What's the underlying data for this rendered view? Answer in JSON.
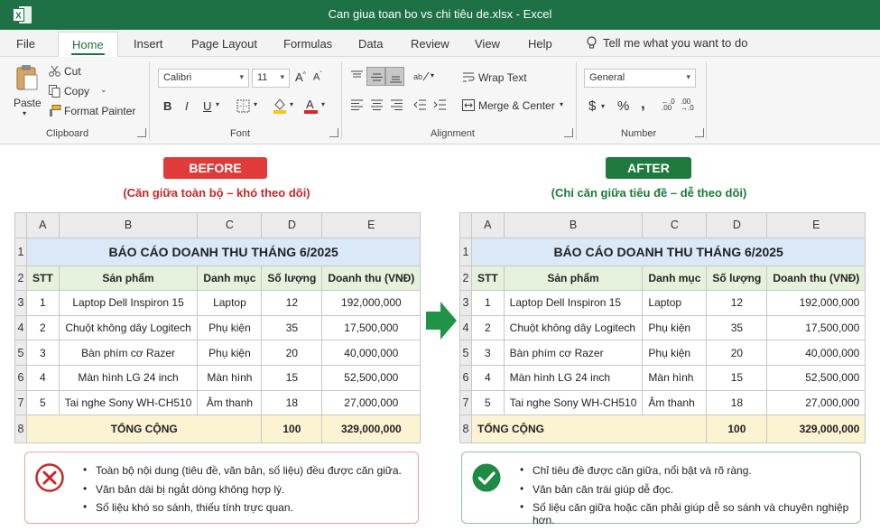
{
  "window": {
    "title": "Can giua toan bo vs chi tiêu de.xlsx  -  Excel",
    "accent": "#1e7145"
  },
  "menu": {
    "tabs": [
      "File",
      "Home",
      "Insert",
      "Page Layout",
      "Formulas",
      "Data",
      "Review",
      "View",
      "Help"
    ],
    "active": "Home",
    "tell_me": "Tell me what you want to do"
  },
  "ribbon": {
    "clipboard": {
      "paste": "Paste",
      "cut": "Cut",
      "copy": "Copy",
      "format_painter": "Format Painter",
      "label": "Clipboard"
    },
    "font": {
      "name": "Calibri",
      "size": "11",
      "bold": "B",
      "italic": "I",
      "underline": "U",
      "font_color_glyph": "A",
      "label": "Font",
      "fill_color": "#f5c518",
      "text_color": "#d9262c"
    },
    "alignment": {
      "wrap_text": "Wrap Text",
      "merge_center": "Merge & Center",
      "label": "Alignment"
    },
    "number": {
      "format": "General",
      "currency": "$",
      "percent": "%",
      "comma": ",",
      "label": "Number"
    }
  },
  "before": {
    "banner": "BEFORE",
    "caption": "(Căn giữa toàn bộ – khó theo dõi)",
    "color": "#e03b3b"
  },
  "after": {
    "banner": "AFTER",
    "caption": "(Chỉ căn giữa tiêu đề – dễ theo dõi)",
    "color": "#1f7a3e"
  },
  "sheet": {
    "columns": [
      "A",
      "B",
      "C",
      "D",
      "E"
    ],
    "row_numbers": [
      "1",
      "2",
      "3",
      "4",
      "5",
      "6",
      "7",
      "8"
    ],
    "title": "BÁO CÁO DOANH THU THÁNG 6/2025",
    "headers": [
      "STT",
      "Sản phẩm",
      "Danh mục",
      "Số lượng",
      "Doanh thu (VNĐ)"
    ],
    "rows": [
      [
        "1",
        "Laptop Dell Inspiron 15",
        "Laptop",
        "12",
        "192,000,000"
      ],
      [
        "2",
        "Chuột không dây Logitech",
        "Phụ kiện",
        "35",
        "17,500,000"
      ],
      [
        "3",
        "Bàn phím cơ Razer",
        "Phụ kiện",
        "20",
        "40,000,000"
      ],
      [
        "4",
        "Màn hình LG 24 inch",
        "Màn hình",
        "15",
        "52,500,000"
      ],
      [
        "5",
        "Tai nghe Sony WH-CH510",
        "Âm thanh",
        "18",
        "27,000,000"
      ]
    ],
    "total_label": "TỔNG CỘNG",
    "total_qty": "100",
    "total_revenue": "329,000,000"
  },
  "notes_before": [
    "Toàn bộ nội dung (tiêu đề, văn bản, số liệu) đều được căn giữa.",
    "Văn bản dài bị ngắt dòng không hợp lý.",
    "Số liệu khó so sánh, thiếu tính trực quan."
  ],
  "notes_after": [
    "Chỉ tiêu đề được căn giữa, nổi bật và rõ ràng.",
    "Văn bản căn trái giúp dễ đọc.",
    "Số liệu căn giữa hoặc căn phải giúp dễ so sánh và chuyên nghiệp hơn."
  ],
  "icons": [
    "excel-logo-icon",
    "lightbulb-icon",
    "paste-icon",
    "scissors-icon",
    "copy-icon",
    "format-painter-icon",
    "arrow-right-icon",
    "cross-circle-icon",
    "check-circle-icon"
  ]
}
